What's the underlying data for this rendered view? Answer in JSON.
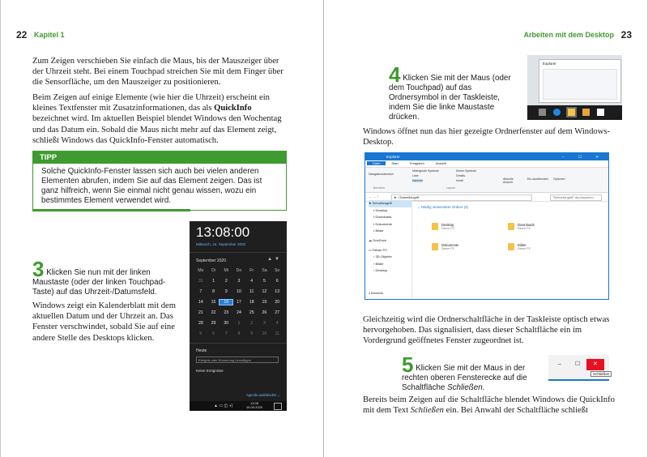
{
  "left": {
    "page_number": "22",
    "chapter": "Kapitel 1",
    "para1": "Zum Zeigen verschieben Sie einfach die Maus, bis der Mauszeiger über der Uhrzeit steht. Bei einem Touchpad streichen Sie mit dem Finger über die Sensorfläche, um den Mauszeiger zu positionieren.",
    "para2_a": "Beim Zeigen auf einige Elemente (wie hier die Uhrzeit) erscheint ein kleines Textfenster mit Zusatzinformationen, das als ",
    "para2_bold": "QuickInfo",
    "para2_b": " bezeichnet wird. Im aktuellen Beispiel blendet Windows den Wochentag und das Datum ein. Sobald die Maus nicht mehr auf das Element zeigt, schließt Windows das QuickInfo-Fenster automatisch.",
    "tip_title": "TIPP",
    "tip_text": "Solche QuickInfo-Fenster lassen sich auch bei vielen anderen Elementen abrufen, indem Sie auf das Element zeigen. Das ist ganz hilfreich, wenn Sie einmal nicht genau wissen, wozu ein bestimmtes Element verwendet wird.",
    "step3_num": "3",
    "step3_text": "Klicken Sie nun mit der linken Maustaste (oder der linken Touchpad-Taste) auf das Uhrzeit-/Datumsfeld.",
    "para3": "Windows zeigt ein Kalenderblatt mit dem aktuellen Datum und der Uhrzeit an. Das Fenster verschwindet, sobald Sie auf eine andere Stelle des Desktops klicken."
  },
  "calendar": {
    "clock": "13:08:00",
    "date": "Mittwoch, 16. September 2020",
    "month": "September 2020",
    "weekdays": [
      "Mo",
      "Di",
      "Mi",
      "Do",
      "Fr",
      "Sa",
      "So"
    ],
    "days": [
      "31",
      "1",
      "2",
      "3",
      "4",
      "5",
      "6",
      "7",
      "8",
      "9",
      "10",
      "11",
      "12",
      "13",
      "14",
      "15",
      "16",
      "17",
      "18",
      "19",
      "20",
      "21",
      "22",
      "23",
      "24",
      "25",
      "26",
      "27",
      "28",
      "29",
      "30",
      "1",
      "2",
      "3",
      "4",
      "5",
      "6",
      "7",
      "8",
      "9",
      "10",
      "11"
    ],
    "notes_label": "Heute",
    "note_placeholder": "Ereignis oder Erinnerung hinzufügen",
    "no_events": "Keine Ereignisse",
    "agenda": "Agenda ausblenden",
    "tray_time": "13:08",
    "tray_date": "16.09.2020"
  },
  "right": {
    "page_number": "23",
    "running_head": "Arbeiten mit dem Desktop",
    "step4_num": "4",
    "step4_text": "Klicken Sie mit der Maus (oder dem Touchpad) auf das Ordnersymbol in der Taskleiste, indem Sie die linke Maustaste drücken.",
    "para1": "Windows öffnet nun das hier gezeigte Ordnerfenster auf dem Windows-Desktop.",
    "para2": "Gleichzeitig wird die Ordnerschaltfläche in der Taskleiste optisch etwas hervorgehoben. Das signalisiert, dass dieser Schaltfläche ein im Vordergrund geöffnetes Fenster zugeordnet ist.",
    "step5_num": "5",
    "step5_a": "Klicken Sie mit der Maus in der rechten oberen Fensterecke auf die Schaltfläche ",
    "step5_italic": "Schließen",
    "step5_b": ".",
    "para3_a": "Bereits beim Zeigen auf die Schaltfläche blendet Windows die QuickInfo mit dem Text ",
    "para3_italic": "Schließen",
    "para3_b": " ein. Bei Anwahl der Schaltfläche schließt"
  },
  "taskbar_shot": {
    "window_title": "Explorer"
  },
  "explorer": {
    "title": "Explorer",
    "tabs": [
      "Datei",
      "Start",
      "Freigeben",
      "Ansicht"
    ],
    "ribbon_items": [
      "Navigationsbereich",
      "Mittelgroße Symbole",
      "Kleine Symbole",
      "Liste",
      "Details",
      "Kacheln",
      "Inhalt",
      "Aktuelle Ansicht",
      "Ein-/ausblenden",
      "Optionen"
    ],
    "ribbon_groups": [
      "Bereiche",
      "Layout"
    ],
    "address": "Schnellzugriff",
    "search": "\"Schnellzugriff\" durchsuchen",
    "nav_items": [
      "Schnellzugriff",
      "Desktop",
      "Downloads",
      "Dokumente",
      "Bilder",
      "OneDrive",
      "Dieser PC",
      "3D-Objekte",
      "Bilder",
      "Desktop"
    ],
    "section": "Häufig verwendete Ordner (4)",
    "folders": [
      {
        "name": "Desktop",
        "sub": "Dieser PC"
      },
      {
        "name": "Downloads",
        "sub": "Dieser PC"
      },
      {
        "name": "Dokumente",
        "sub": "Dieser PC"
      },
      {
        "name": "Bilder",
        "sub": "Dieser PC"
      }
    ],
    "status": "4 Elemente"
  },
  "close_shot": {
    "minimize": "–",
    "maximize": "☐",
    "close": "✕",
    "tooltip": "Schließen"
  },
  "colors": {
    "accent_green": "#3f9a2f",
    "windows_blue": "#1976d2",
    "close_red": "#e81123"
  }
}
